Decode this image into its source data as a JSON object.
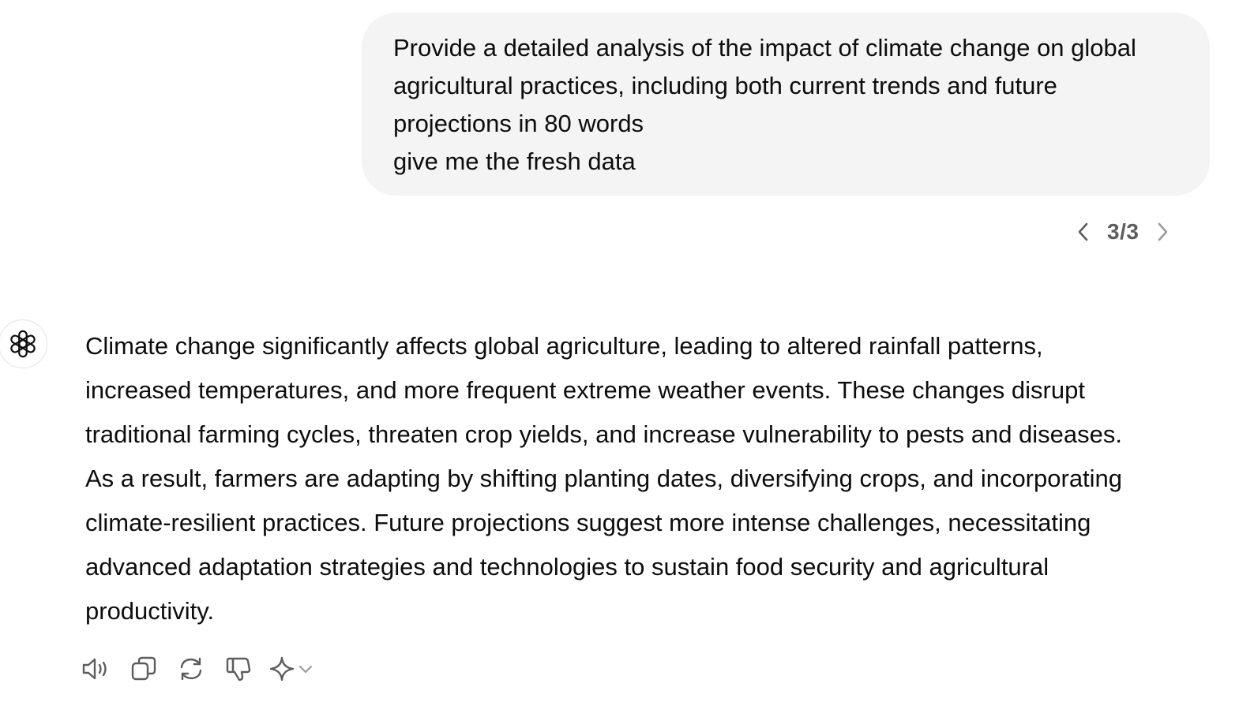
{
  "user_message": {
    "lines": [
      "Provide a detailed analysis of the impact of climate change on global",
      "agricultural practices, including both current trends and future",
      "projections in 80 words",
      "give me the fresh data"
    ]
  },
  "pager": {
    "label": "3/3",
    "prev_icon": "chevron-left-icon",
    "next_icon": "chevron-right-icon"
  },
  "assistant": {
    "avatar_icon": "openai-logo-icon",
    "lines": [
      "Climate change significantly affects global agriculture, leading to altered rainfall patterns,",
      "increased temperatures, and more frequent extreme weather events. These changes disrupt",
      "traditional farming cycles, threaten crop yields, and increase vulnerability to pests and diseases.",
      "As a result, farmers are adapting by shifting planting dates, diversifying crops, and incorporating",
      "climate-resilient practices. Future projections suggest more intense challenges, necessitating",
      "advanced adaptation strategies and technologies to sustain food security and agricultural",
      "productivity."
    ]
  },
  "actions": {
    "icons": [
      "speaker-icon",
      "copy-icon",
      "regenerate-icon",
      "thumbs-down-icon",
      "sparkle-icon",
      "chevron-down-icon"
    ]
  },
  "colors": {
    "bubble_bg": "#f4f4f4",
    "text": "#0d0d0d",
    "muted": "#5d5d5d",
    "icon": "#5d5d5d"
  }
}
